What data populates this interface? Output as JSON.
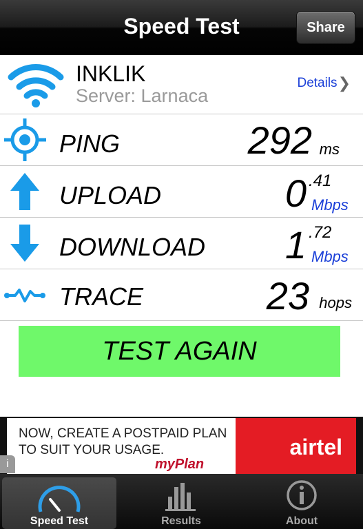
{
  "navbar": {
    "title": "Speed Test",
    "share_label": "Share"
  },
  "server": {
    "isp": "INKLIK",
    "server_text": "Server: Larnaca",
    "details_label": "Details"
  },
  "metrics": {
    "ping": {
      "label": "PING",
      "value": "292",
      "unit": "ms"
    },
    "upload": {
      "label": "UPLOAD",
      "whole": "0",
      "fraction": ".41",
      "unit": "Mbps"
    },
    "download": {
      "label": "DOWNLOAD",
      "whole": "1",
      "fraction": ".72",
      "unit": "Mbps"
    },
    "trace": {
      "label": "TRACE",
      "value": "23",
      "unit": "hops"
    }
  },
  "actions": {
    "test_again_label": "TEST AGAIN"
  },
  "ad": {
    "line1": "NOW, CREATE A POSTPAID PLAN",
    "line2": "TO SUIT YOUR USAGE.",
    "plan_name": "myPlan",
    "brand": "airtel",
    "accent_color": "#e41c24"
  },
  "tabs": [
    {
      "label": "Speed Test",
      "icon": "speedometer-icon",
      "active": true
    },
    {
      "label": "Results",
      "icon": "bar-chart-icon",
      "active": false
    },
    {
      "label": "About",
      "icon": "info-icon",
      "active": false
    }
  ],
  "colors": {
    "accent_blue": "#1a9be8",
    "link_blue": "#1a3fd8",
    "button_green": "#6ff86a"
  }
}
